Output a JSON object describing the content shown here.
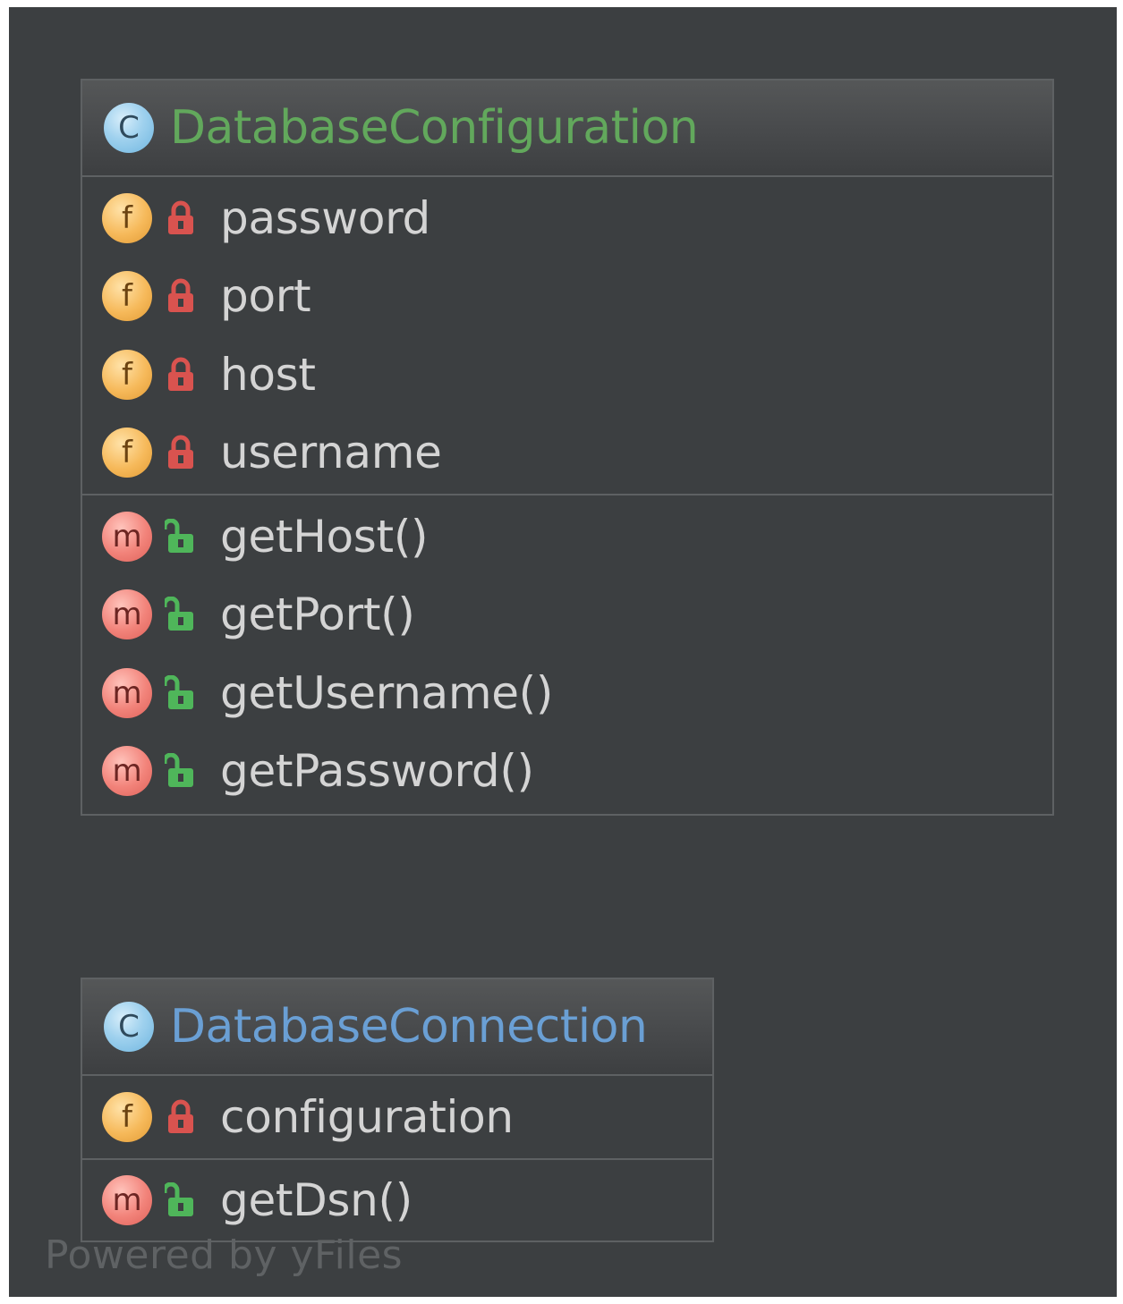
{
  "diagram": {
    "classes": [
      {
        "id": "database-configuration",
        "kind_letter": "C",
        "name": "DatabaseConfiguration",
        "name_color": "#62a85c",
        "fields": [
          {
            "letter": "f",
            "visibility": "private",
            "name": "password"
          },
          {
            "letter": "f",
            "visibility": "private",
            "name": "port"
          },
          {
            "letter": "f",
            "visibility": "private",
            "name": "host"
          },
          {
            "letter": "f",
            "visibility": "private",
            "name": "username"
          }
        ],
        "methods": [
          {
            "letter": "m",
            "visibility": "public",
            "name": "getHost()"
          },
          {
            "letter": "m",
            "visibility": "public",
            "name": "getPort()"
          },
          {
            "letter": "m",
            "visibility": "public",
            "name": "getUsername()"
          },
          {
            "letter": "m",
            "visibility": "public",
            "name": "getPassword()"
          }
        ]
      },
      {
        "id": "database-connection",
        "kind_letter": "C",
        "name": "DatabaseConnection",
        "name_color": "#6a9fd4",
        "fields": [
          {
            "letter": "f",
            "visibility": "private",
            "name": "configuration"
          }
        ],
        "methods": [
          {
            "letter": "m",
            "visibility": "public",
            "name": "getDsn()"
          }
        ]
      }
    ],
    "watermark": "Powered by yFiles",
    "colors": {
      "background": "#3c3f41",
      "border": "#5e6163",
      "member_text": "#d4d4d4",
      "private_lock": "#d9534f",
      "public_lock": "#4fb65a"
    },
    "icons": {
      "class": "class-icon",
      "field": "field-icon",
      "method": "method-icon",
      "private": "lock-closed-icon",
      "public": "lock-open-icon"
    }
  }
}
